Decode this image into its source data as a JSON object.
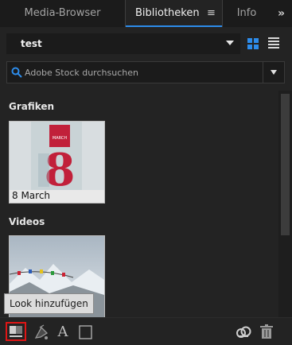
{
  "tabs": {
    "media_browser": "Media-Browser",
    "libraries": "Bibliotheken",
    "info": "Info",
    "menu_glyph": "≡",
    "overflow_glyph": "»"
  },
  "library": {
    "selected": "test"
  },
  "search": {
    "placeholder": "Adobe Stock durchsuchen",
    "value": ""
  },
  "sections": [
    {
      "heading": "Grafiken",
      "items": [
        {
          "caption": "8 March"
        }
      ]
    },
    {
      "heading": "Videos",
      "items": [
        {
          "caption": ""
        }
      ]
    }
  ],
  "graphic_text": {
    "small": "MARCH",
    "big": "8"
  },
  "tooltip": "Look hinzufügen",
  "bottom_toolbar": {
    "text_style_glyph": "A"
  },
  "colors": {
    "accent": "#2d8ceb",
    "highlight": "#e01515",
    "panel": "#232323"
  }
}
